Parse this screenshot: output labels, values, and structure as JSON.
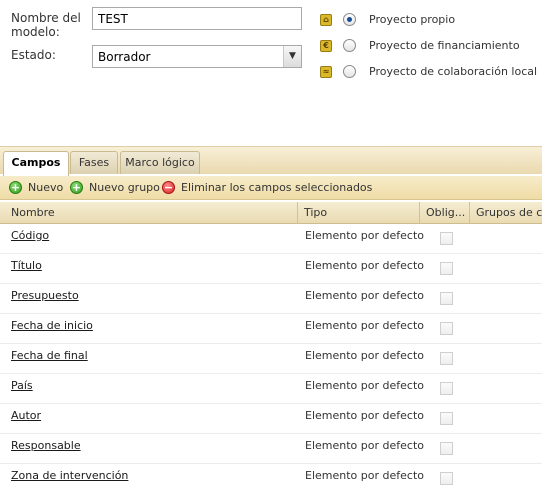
{
  "form": {
    "name_label": "Nombre del modelo:",
    "name_value": "TEST",
    "estado_label": "Estado:",
    "estado_value": "Borrador"
  },
  "project_types": [
    {
      "label": "Proyecto propio",
      "icon": "house-icon",
      "selected": true
    },
    {
      "label": "Proyecto de financiamiento",
      "icon": "euro-icon",
      "selected": false
    },
    {
      "label": "Proyecto de colaboración local",
      "icon": "handshake-icon",
      "selected": false
    }
  ],
  "tabs": [
    {
      "label": "Campos",
      "active": true
    },
    {
      "label": "Fases",
      "active": false
    },
    {
      "label": "Marco lógico",
      "active": false
    }
  ],
  "toolbar": {
    "nuevo": "Nuevo",
    "nuevo_grupo": "Nuevo grupo",
    "eliminar": "Eliminar los campos seleccionados"
  },
  "table": {
    "columns": [
      "Nombre",
      "Tipo",
      "Oblig...",
      "Grupos de co"
    ],
    "rows": [
      {
        "nombre": "Código",
        "tipo": "Elemento por defecto"
      },
      {
        "nombre": "Título",
        "tipo": "Elemento por defecto"
      },
      {
        "nombre": "Presupuesto",
        "tipo": "Elemento por defecto"
      },
      {
        "nombre": "Fecha de inicio",
        "tipo": "Elemento por defecto"
      },
      {
        "nombre": "Fecha de final",
        "tipo": "Elemento por defecto"
      },
      {
        "nombre": "País",
        "tipo": "Elemento por defecto"
      },
      {
        "nombre": "Autor",
        "tipo": "Elemento por defecto"
      },
      {
        "nombre": "Responsable",
        "tipo": "Elemento por defecto"
      },
      {
        "nombre": "Zona de intervención",
        "tipo": "Elemento por defecto"
      }
    ]
  },
  "colors": {
    "tab_bar": "#ead9ae",
    "toolbar": "#efdca6",
    "accent_radio": "#1b4f9a"
  }
}
